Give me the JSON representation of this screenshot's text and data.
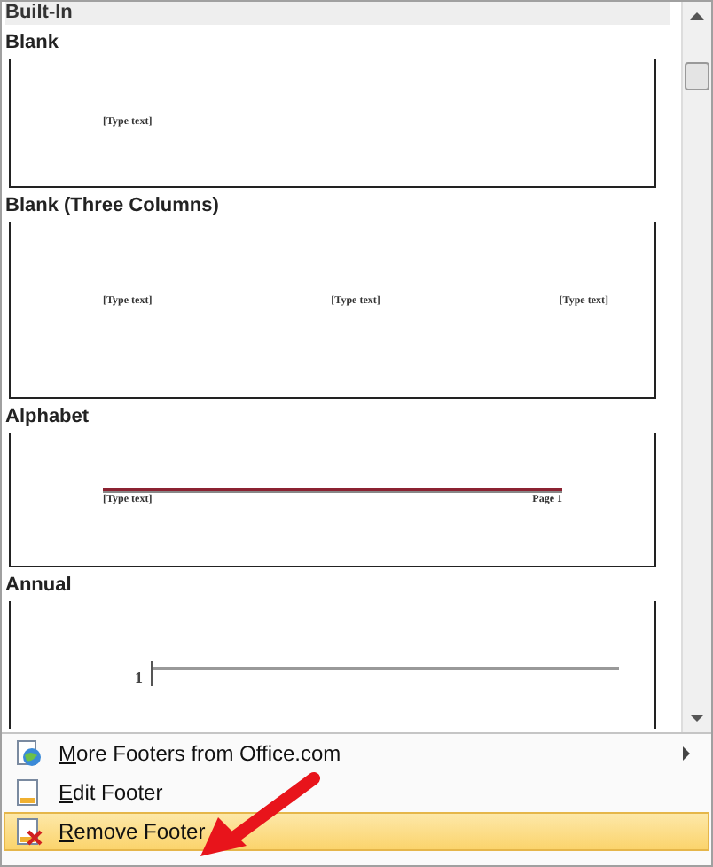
{
  "gallery": {
    "heading": "Built-In",
    "items": [
      {
        "name": "Blank",
        "kind": "blank",
        "texts": [
          "[Type text]"
        ]
      },
      {
        "name": "Blank (Three Columns)",
        "kind": "three",
        "texts": [
          "[Type text]",
          "[Type text]",
          "[Type text]"
        ]
      },
      {
        "name": "Alphabet",
        "kind": "alphabet",
        "texts": [
          "[Type text]",
          "Page 1"
        ]
      },
      {
        "name": "Annual",
        "kind": "annual",
        "texts": [
          "1"
        ]
      }
    ]
  },
  "menu": [
    {
      "label": "More Footers from Office.com",
      "kind": "office",
      "submenu": true,
      "selected": false
    },
    {
      "label": "Edit Footer",
      "kind": "edit",
      "submenu": false,
      "selected": false
    },
    {
      "label": "Remove Footer",
      "kind": "remove",
      "submenu": false,
      "selected": true
    }
  ]
}
